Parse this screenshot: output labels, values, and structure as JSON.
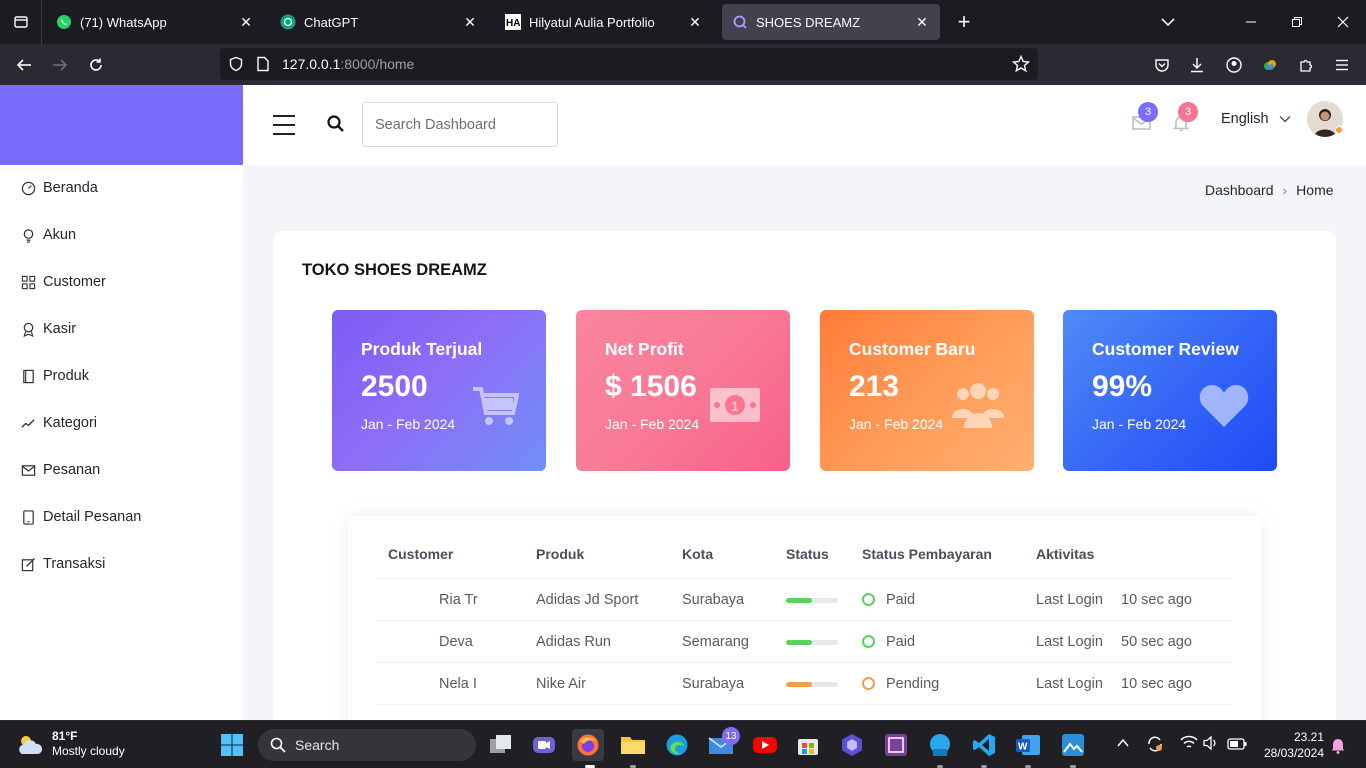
{
  "browser": {
    "tabs": [
      {
        "title": "(71) WhatsApp",
        "icon": "whatsapp-icon",
        "active": false
      },
      {
        "title": "ChatGPT",
        "icon": "chatgpt-icon",
        "active": false
      },
      {
        "title": "Hilyatul Aulia Portfolio",
        "icon": "ha-logo-icon",
        "active": false
      },
      {
        "title": "SHOES DREAMZ",
        "icon": "loading-icon",
        "active": true
      }
    ],
    "url_host": "127.0.0.1",
    "url_rest": ":8000/home"
  },
  "sidebar": {
    "items": [
      {
        "label": "Beranda",
        "icon": "dashboard-gauge-icon"
      },
      {
        "label": "Akun",
        "icon": "lightbulb-icon"
      },
      {
        "label": "Customer",
        "icon": "grid-icon"
      },
      {
        "label": "Kasir",
        "icon": "award-icon"
      },
      {
        "label": "Produk",
        "icon": "book-icon"
      },
      {
        "label": "Kategori",
        "icon": "trend-line-icon"
      },
      {
        "label": "Pesanan",
        "icon": "envelope-icon"
      },
      {
        "label": "Detail Pesanan",
        "icon": "tablet-icon"
      },
      {
        "label": "Transaksi",
        "icon": "edit-icon"
      }
    ]
  },
  "header": {
    "search_placeholder": "Search Dashboard",
    "mail_badge": "3",
    "bell_badge": "3",
    "language": "English"
  },
  "breadcrumb": {
    "parent": "Dashboard",
    "current": "Home"
  },
  "main": {
    "title": "TOKO SHOES DREAMZ",
    "stats": [
      {
        "title": "Produk Terjual",
        "value": "2500",
        "period": "Jan - Feb 2024",
        "icon": "cart-icon"
      },
      {
        "title": "Net Profit",
        "value": "$ 1506",
        "period": "Jan - Feb 2024",
        "icon": "money-icon"
      },
      {
        "title": "Customer Baru",
        "value": "213",
        "period": "Jan - Feb 2024",
        "icon": "users-icon"
      },
      {
        "title": "Customer Review",
        "value": "99%",
        "period": "Jan - Feb 2024",
        "icon": "heart-icon"
      }
    ],
    "table": {
      "headers": [
        "Customer",
        "Produk",
        "Kota",
        "Status",
        "Status Pembayaran",
        "Aktivitas"
      ],
      "rows": [
        {
          "customer": "Ria Tr",
          "produk": "Adidas Jd Sport",
          "kota": "Surabaya",
          "status_progress": 0.5,
          "status_color": "#5cd05c",
          "payment": "Paid",
          "payment_color": "#5cd05c",
          "activity": "Last Login",
          "time": "10 sec ago"
        },
        {
          "customer": "Deva",
          "produk": "Adidas Run",
          "kota": "Semarang",
          "status_progress": 0.5,
          "status_color": "#5cd05c",
          "payment": "Paid",
          "payment_color": "#5cd05c",
          "activity": "Last Login",
          "time": "50 sec ago"
        },
        {
          "customer": "Nela I",
          "produk": "Nike Air",
          "kota": "Surabaya",
          "status_progress": 0.5,
          "status_color": "#f0a04b",
          "payment": "Pending",
          "payment_color": "#f0a04b",
          "activity": "Last Login",
          "time": "10 sec ago"
        }
      ]
    }
  },
  "taskbar": {
    "weather_temp": "81°F",
    "weather_desc": "Mostly cloudy",
    "search_label": "Search",
    "mail_badge": "13",
    "time": "23.21",
    "date": "28/03/2024"
  }
}
